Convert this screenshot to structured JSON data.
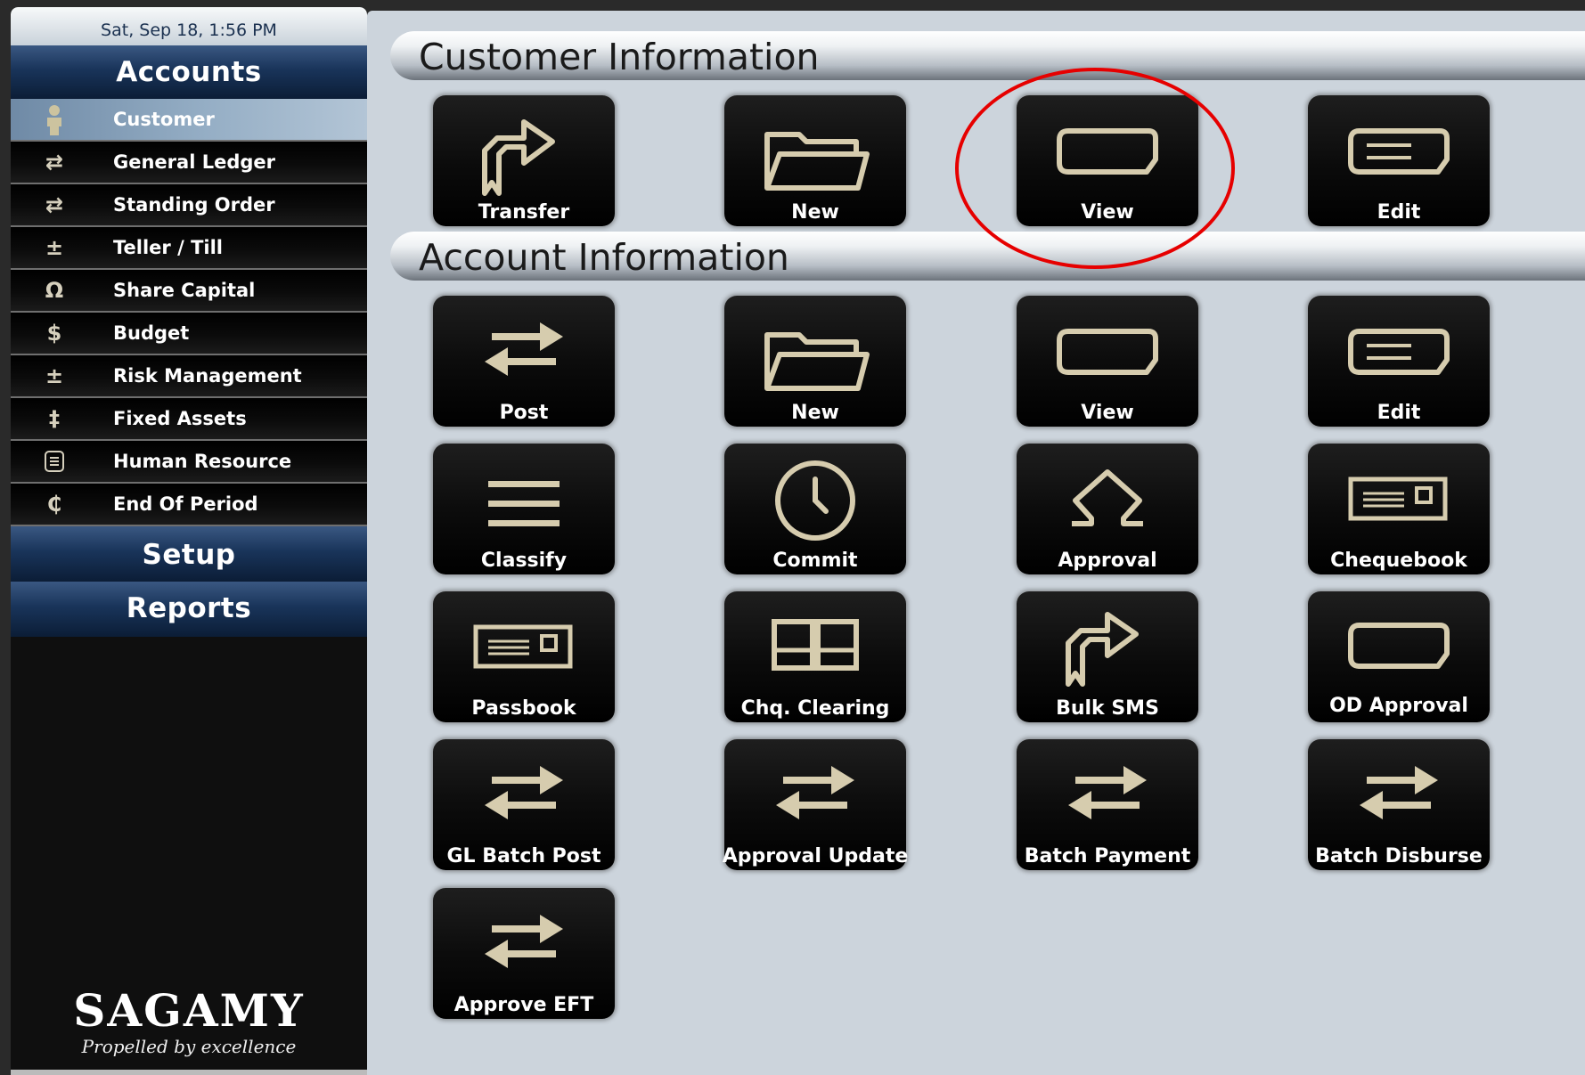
{
  "sidebar": {
    "datetime": "Sat, Sep 18, 1:56 PM",
    "accounts_header": "Accounts",
    "items": [
      {
        "label": "Customer",
        "icon": "person-icon"
      },
      {
        "label": "General Ledger",
        "icon": "exchange-icon"
      },
      {
        "label": "Standing Order",
        "icon": "exchange-icon"
      },
      {
        "label": "Teller / Till",
        "icon": "plus-minus-icon"
      },
      {
        "label": "Share Capital",
        "icon": "omega-icon"
      },
      {
        "label": "Budget",
        "icon": "dollar-icon"
      },
      {
        "label": "Risk Management",
        "icon": "plus-minus-icon"
      },
      {
        "label": "Fixed Assets",
        "icon": "double-dagger-icon"
      },
      {
        "label": "Human Resource",
        "icon": "document-icon"
      },
      {
        "label": "End Of Period",
        "icon": "cedi-icon"
      }
    ],
    "selected_item": "Customer",
    "setup_header": "Setup",
    "reports_header": "Reports",
    "brand_name": "SAGAMY",
    "brand_tagline": "Propelled by excellence"
  },
  "main": {
    "customer_section": {
      "title": "Customer Information",
      "tiles": [
        {
          "label": "Transfer",
          "icon": "share-arrow-icon"
        },
        {
          "label": "New",
          "icon": "folder-icon"
        },
        {
          "label": "View",
          "icon": "tag-icon"
        },
        {
          "label": "Edit",
          "icon": "tag-lines-icon"
        }
      ]
    },
    "account_section": {
      "title": "Account Information",
      "tiles": [
        {
          "label": "Post",
          "icon": "exchange-arrows-icon"
        },
        {
          "label": "New",
          "icon": "folder-icon"
        },
        {
          "label": "View",
          "icon": "tag-icon"
        },
        {
          "label": "Edit",
          "icon": "tag-lines-icon"
        },
        {
          "label": "Classify",
          "icon": "menu-lines-icon"
        },
        {
          "label": "Commit",
          "icon": "clock-icon"
        },
        {
          "label": "Approval",
          "icon": "omega-icon"
        },
        {
          "label": "Chequebook",
          "icon": "card-icon"
        },
        {
          "label": "Passbook",
          "icon": "card-icon"
        },
        {
          "label": "Chq. Clearing",
          "icon": "book-icon"
        },
        {
          "label": "Bulk SMS",
          "icon": "share-arrow-icon"
        },
        {
          "label": "OD Approval",
          "icon": "tag-icon"
        },
        {
          "label": "GL Batch Post",
          "icon": "exchange-arrows-icon"
        },
        {
          "label": "Approval Update",
          "icon": "exchange-arrows-icon"
        },
        {
          "label": "Batch Payment",
          "icon": "exchange-arrows-icon"
        },
        {
          "label": "Batch Disburse",
          "icon": "exchange-arrows-icon"
        },
        {
          "label": "Approve EFT",
          "icon": "exchange-arrows-icon"
        }
      ]
    }
  },
  "colors": {
    "icon_gold": "#d6ccae",
    "highlight_red": "#e60000",
    "nav_blue": "#19345a"
  }
}
